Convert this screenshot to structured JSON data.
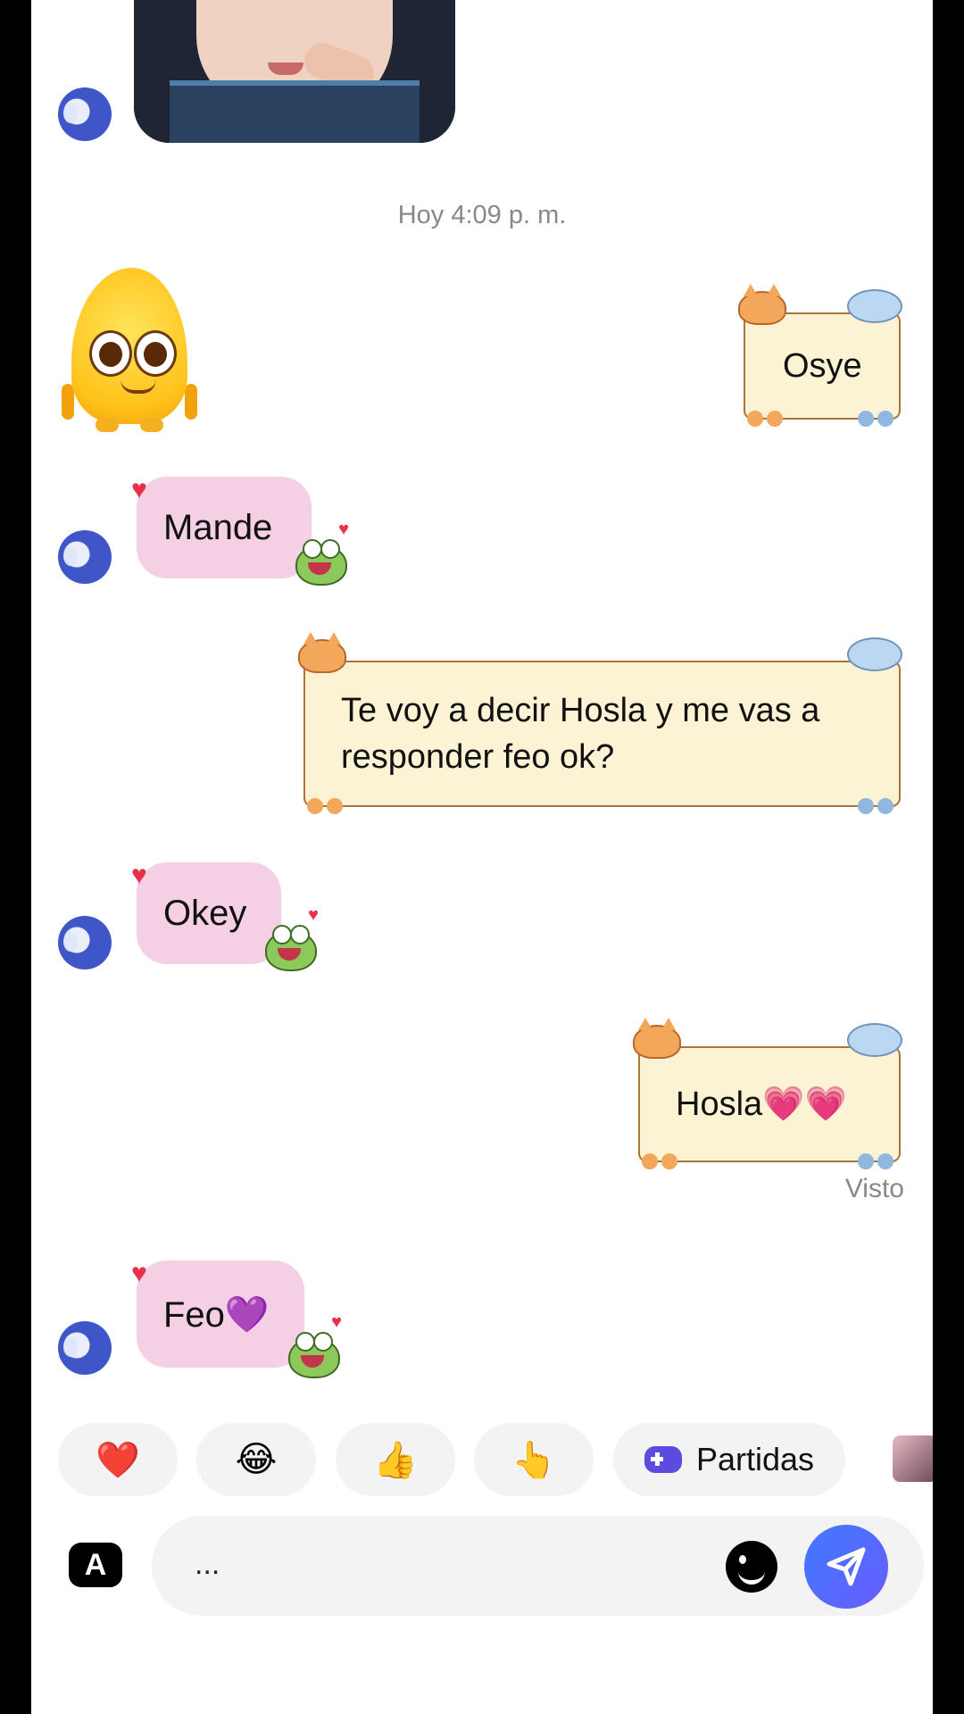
{
  "chat": {
    "timestamp": "Hoy 4:09 p. m.",
    "messages": [
      {
        "from": "me",
        "text": "Osye"
      },
      {
        "from": "them",
        "text": "Mande"
      },
      {
        "from": "me",
        "text": "Te voy a decir Hosla y me vas a responder feo ok?"
      },
      {
        "from": "them",
        "text": "Okey"
      },
      {
        "from": "me",
        "text": "Hosla💗💗"
      },
      {
        "from": "them",
        "text": "Feo💜"
      }
    ],
    "seen_label": "Visto"
  },
  "quick_replies": [
    {
      "emoji": "❤️",
      "icon": "heart-icon"
    },
    {
      "emoji": "😂",
      "icon": "laugh-icon"
    },
    {
      "emoji": "👍",
      "icon": "thumbs-up-icon"
    },
    {
      "emoji": "👆",
      "icon": "pointing-hand-icon"
    },
    {
      "label": "Partidas",
      "icon": "gamepad-icon"
    }
  ],
  "composer": {
    "text": "...",
    "keyboard_badge": "A"
  },
  "colors": {
    "my_note_bg": "#fbf3d4",
    "their_bubble_bg": "#f5cfe3",
    "send_button": "#4a6cff"
  }
}
